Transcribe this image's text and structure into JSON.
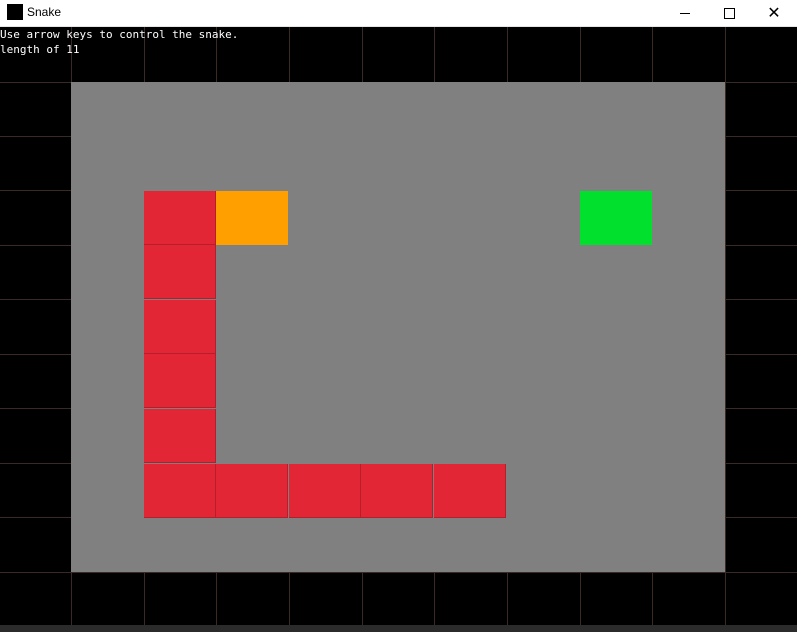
{
  "window": {
    "title": "Snake",
    "app_icon": "black-square-icon",
    "controls": [
      "minimize-icon",
      "maximize-icon",
      "close-icon"
    ]
  },
  "hud": {
    "instructions": "Use arrow keys to control the snake.",
    "length_text": "length of 11"
  },
  "game": {
    "snake_length": 11,
    "colors": {
      "background": "#000000",
      "board": "#808080",
      "snake": "#e32636",
      "head": "#ffa000",
      "food": "#00e02c"
    }
  }
}
